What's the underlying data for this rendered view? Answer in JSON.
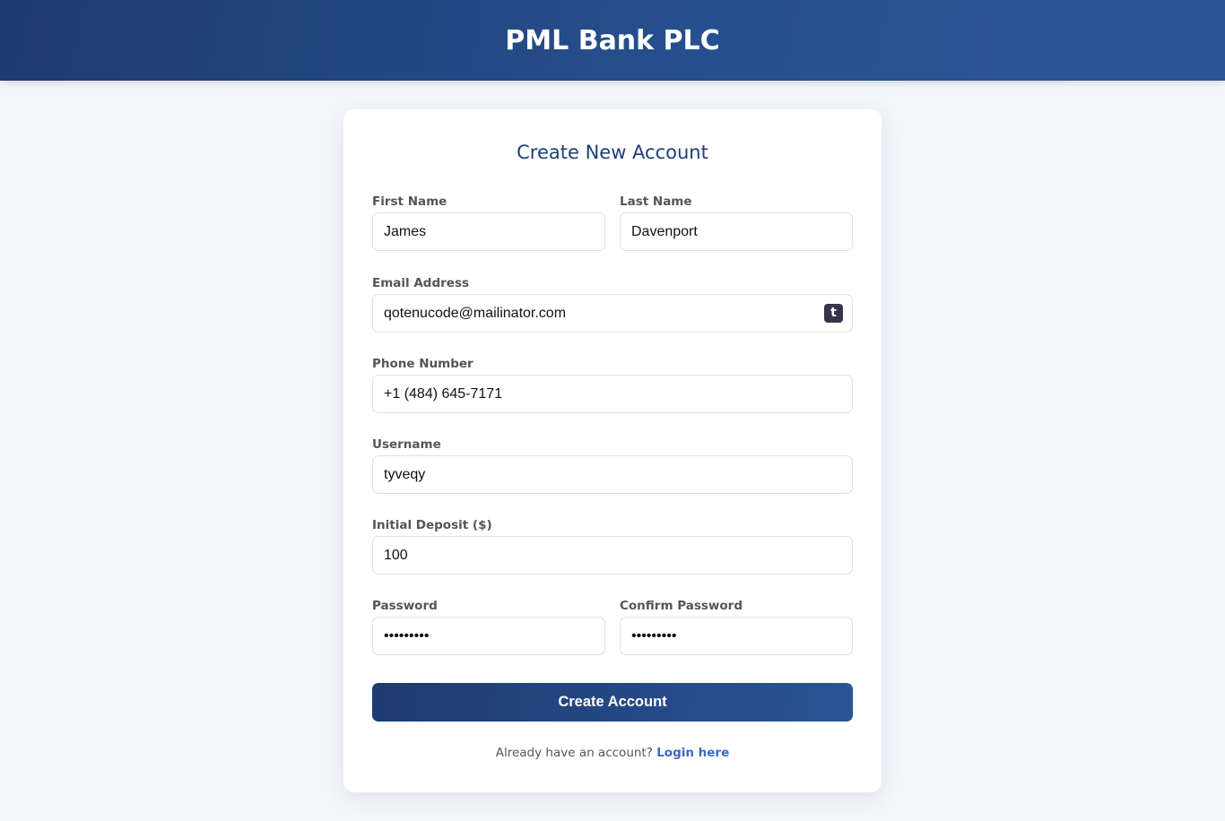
{
  "header": {
    "title": "PML Bank PLC"
  },
  "form": {
    "title": "Create New Account",
    "first_name": {
      "label": "First Name",
      "value": "James"
    },
    "last_name": {
      "label": "Last Name",
      "value": "Davenport"
    },
    "email": {
      "label": "Email Address",
      "value": "qotenucode@mailinator.com",
      "icon": "tumblr-icon"
    },
    "phone": {
      "label": "Phone Number",
      "value": "+1 (484) 645-7171"
    },
    "username": {
      "label": "Username",
      "value": "tyveqy"
    },
    "deposit": {
      "label": "Initial Deposit ($)",
      "value": "100"
    },
    "password": {
      "label": "Password",
      "value": "Pa$$w0rd!"
    },
    "confirm_password": {
      "label": "Confirm Password",
      "value": "Pa$$w0rd!"
    },
    "submit_label": "Create Account",
    "login_prompt": "Already have an account?",
    "login_link": "Login here"
  },
  "colors": {
    "header_start": "#1f3b70",
    "header_end": "#2c5599",
    "title": "#1f3f74",
    "link": "#3a68c9",
    "background": "#f4f6fa"
  }
}
